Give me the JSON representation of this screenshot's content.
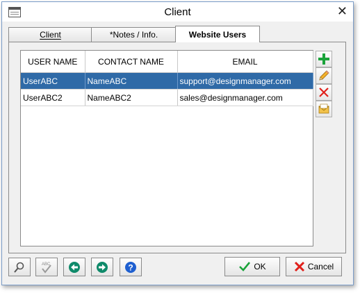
{
  "window": {
    "title": "Client"
  },
  "tabs": [
    {
      "label": "Client",
      "active": false
    },
    {
      "label": "*Notes / Info.",
      "active": false
    },
    {
      "label": "Website Users",
      "active": true
    }
  ],
  "grid": {
    "columns": [
      "USER NAME",
      "CONTACT NAME",
      "EMAIL"
    ],
    "rows": [
      {
        "user_name": "UserABC",
        "contact_name": "NameABC",
        "email": "support@designmanager.com",
        "selected": true
      },
      {
        "user_name": "UserABC2",
        "contact_name": "NameABC2",
        "email": "sales@designmanager.com",
        "selected": false
      }
    ]
  },
  "side_actions": [
    "add-icon",
    "edit-pencil-icon",
    "delete-x-icon",
    "email-envelope-icon"
  ],
  "footer": {
    "ok_label": "OK",
    "cancel_label": "Cancel",
    "spell_label": "ABC"
  },
  "colors": {
    "selection": "#2f6aa7",
    "add_green": "#1aa33a",
    "delete_red": "#e0201b",
    "nav_teal": "#0f8a6a",
    "help_blue": "#1e5fd0"
  }
}
